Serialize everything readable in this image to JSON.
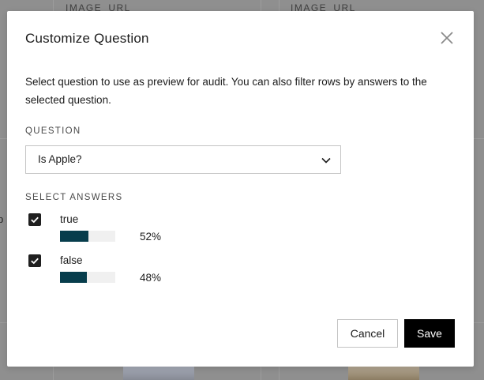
{
  "background": {
    "column_headers": [
      "IMAGE_URL",
      "IMAGE_URL"
    ],
    "side_text_fragment": "p"
  },
  "dialog": {
    "title": "Customize Question",
    "description": "Select question to use as preview for audit. You can also filter rows by answers to the selected question.",
    "question_label": "QUESTION",
    "question_selected": "Is Apple?",
    "answers_label": "SELECT ANSWERS",
    "answers": [
      {
        "label": "true",
        "checked": true,
        "percent_text": "52%",
        "fraction": 0.52
      },
      {
        "label": "false",
        "checked": true,
        "percent_text": "48%",
        "fraction": 0.48
      }
    ],
    "buttons": {
      "cancel": "Cancel",
      "save": "Save"
    }
  },
  "colors": {
    "backdrop": "#8f8f8f",
    "bar_fill": "#073d4c",
    "bar_track": "#f0f0f0",
    "primary_button": "#000000"
  },
  "icons": {
    "close": "close-icon",
    "select": "chevron-down-icon",
    "check": "checkmark-icon"
  }
}
